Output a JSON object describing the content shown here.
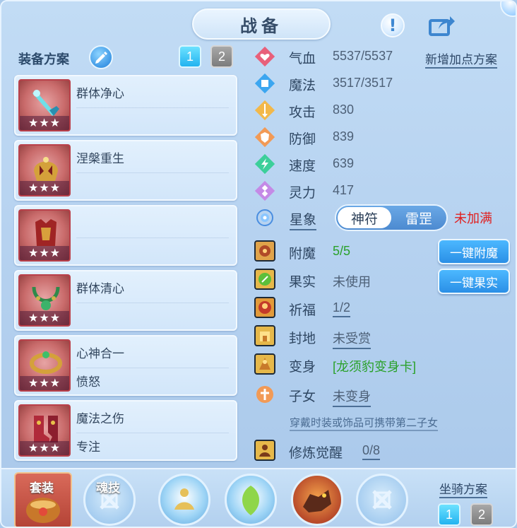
{
  "header": {
    "title": "战备",
    "info_icon": "info-icon",
    "share_icon": "share-icon"
  },
  "equip_plans": {
    "title": "装备方案",
    "tabs": [
      "1",
      "2"
    ],
    "selected_tab": "1",
    "cards": [
      {
        "name": "群体净心",
        "sub": "",
        "stars": "★★★",
        "icon": "ice-sword-icon"
      },
      {
        "name": "涅槃重生",
        "sub": "",
        "stars": "★★★",
        "icon": "golden-helmet-icon"
      },
      {
        "name": "",
        "sub": "",
        "stars": "★★★",
        "icon": "red-armor-icon"
      },
      {
        "name": "群体清心",
        "sub": "",
        "stars": "★★★",
        "icon": "jade-necklace-icon"
      },
      {
        "name": "心神合一",
        "sub": "愤怒",
        "stars": "★★★",
        "icon": "golden-belt-icon"
      },
      {
        "name": "魔法之伤",
        "sub": "专注",
        "stars": "★★★",
        "icon": "red-boots-icon"
      }
    ]
  },
  "stats": {
    "add_plan_label": "新增加点方案",
    "items": [
      {
        "label": "气血",
        "value": "5537/5537",
        "icon": "heart-icon"
      },
      {
        "label": "魔法",
        "value": "3517/3517",
        "icon": "mana-icon"
      },
      {
        "label": "攻击",
        "value": "830",
        "icon": "attack-icon"
      },
      {
        "label": "防御",
        "value": "839",
        "icon": "defense-icon"
      },
      {
        "label": "速度",
        "value": "639",
        "icon": "speed-icon"
      },
      {
        "label": "灵力",
        "value": "417",
        "icon": "spirit-icon"
      }
    ],
    "star_sign": {
      "label": "星象",
      "options": [
        "神符",
        "雷罡"
      ],
      "selected": "神符",
      "status": "未加满"
    }
  },
  "extras": {
    "enchant": {
      "label": "附魔",
      "value": "5/5",
      "button": "一键附魔"
    },
    "fruit": {
      "label": "果实",
      "value": "未使用",
      "button": "一键果实"
    },
    "bless": {
      "label": "祈福",
      "value": "1/2"
    },
    "fief": {
      "label": "封地",
      "value": "未受赏"
    },
    "transform": {
      "label": "变身",
      "value": "[龙须豹变身卡]"
    },
    "child": {
      "label": "子女",
      "value": "未变身",
      "note": "穿戴时装或饰品可携带第二子女"
    },
    "cultivate": {
      "label": "修炼觉醒",
      "value": "0/8"
    }
  },
  "bottom": {
    "suit_label": "套装",
    "soul_label": "魂技",
    "mount_title": "坐骑方案",
    "mount_tabs": [
      "1",
      "2"
    ],
    "mount_selected": "1"
  },
  "colors": {
    "accent_blue": "#2a8fe6",
    "warning_red": "#e02020",
    "good_green": "#2aa12a"
  }
}
